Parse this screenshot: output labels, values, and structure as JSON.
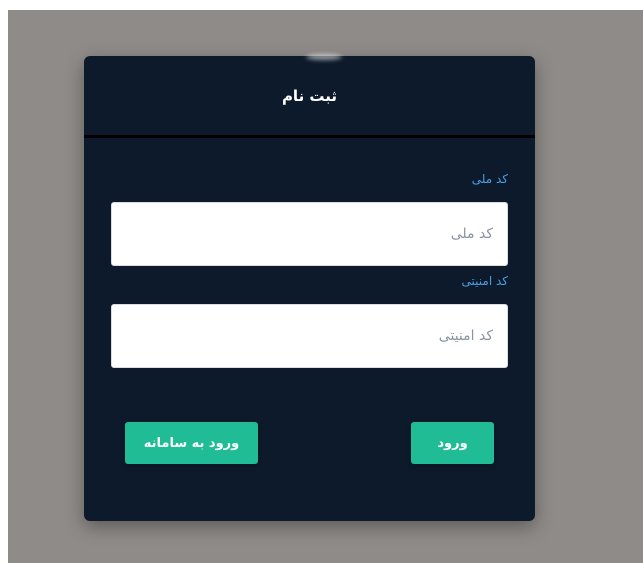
{
  "form": {
    "title": "ثبت نام",
    "national_code": {
      "label": "کد ملی",
      "placeholder": "کد ملی",
      "value": ""
    },
    "security_code": {
      "label": "کد امنیتی",
      "placeholder": "کد امنیتی",
      "value": ""
    },
    "buttons": {
      "login_label": "ورود",
      "enter_system_label": "ورود به سامانه"
    }
  },
  "colors": {
    "backdrop": "#8f8b88",
    "card_background": "#0d1a2b",
    "label_blue": "#4a9fe0",
    "button_green": "#1fbc95"
  }
}
